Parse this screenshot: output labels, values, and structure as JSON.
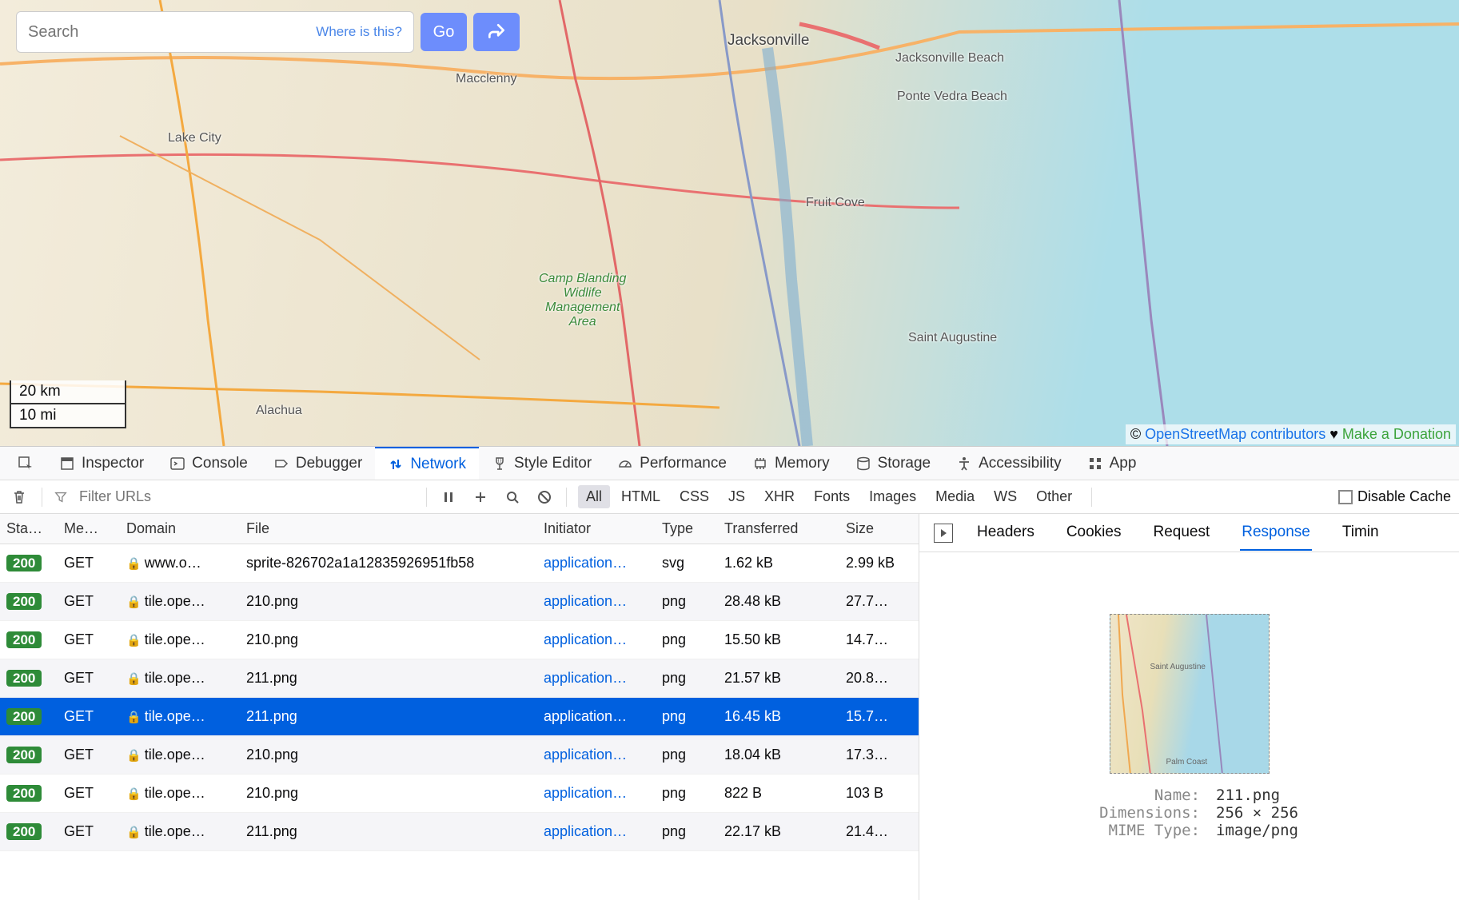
{
  "search": {
    "placeholder": "Search",
    "where_is_this": "Where is this?",
    "go_label": "Go"
  },
  "scale": {
    "km": "20 km",
    "mi": "10 mi"
  },
  "attribution": {
    "prefix": "© ",
    "link_text": "OpenStreetMap contributors",
    "heart": " ♥ ",
    "donate_text": "Make a Donation"
  },
  "map_labels": {
    "jacksonville": "Jacksonville",
    "jax_beach": "Jacksonville\nBeach",
    "ponte_vedra": "Ponte Vedra\nBeach",
    "fruit_cove": "Fruit Cove",
    "st_augustine": "Saint Augustine",
    "lake_city": "Lake City",
    "alachua": "Alachua",
    "macclenny": "Macclenny",
    "camp_blanding": "Camp Blanding\nWidlife\nManagement\nArea"
  },
  "devtools_tabs": [
    "Inspector",
    "Console",
    "Debugger",
    "Network",
    "Style Editor",
    "Performance",
    "Memory",
    "Storage",
    "Accessibility",
    "Application"
  ],
  "devtools_active_tab": "Network",
  "toolbar": {
    "filter_placeholder": "Filter URLs",
    "types": [
      "All",
      "HTML",
      "CSS",
      "JS",
      "XHR",
      "Fonts",
      "Images",
      "Media",
      "WS",
      "Other"
    ],
    "active_type": "All",
    "disable_cache": "Disable Cache"
  },
  "columns": {
    "status": "Sta…",
    "method": "Me…",
    "domain": "Domain",
    "file": "File",
    "initiator": "Initiator",
    "type": "Type",
    "transferred": "Transferred",
    "size": "Size"
  },
  "requests": [
    {
      "status": "200",
      "method": "GET",
      "domain": "www.o…",
      "file": "sprite-826702a1a12835926951fb58",
      "initiator": "application…",
      "type": "svg",
      "transferred": "1.62 kB",
      "size": "2.99 kB"
    },
    {
      "status": "200",
      "method": "GET",
      "domain": "tile.ope…",
      "file": "210.png",
      "initiator": "application…",
      "type": "png",
      "transferred": "28.48 kB",
      "size": "27.7…"
    },
    {
      "status": "200",
      "method": "GET",
      "domain": "tile.ope…",
      "file": "210.png",
      "initiator": "application…",
      "type": "png",
      "transferred": "15.50 kB",
      "size": "14.7…"
    },
    {
      "status": "200",
      "method": "GET",
      "domain": "tile.ope…",
      "file": "211.png",
      "initiator": "application…",
      "type": "png",
      "transferred": "21.57 kB",
      "size": "20.8…"
    },
    {
      "status": "200",
      "method": "GET",
      "domain": "tile.ope…",
      "file": "211.png",
      "initiator": "application…",
      "type": "png",
      "transferred": "16.45 kB",
      "size": "15.7…",
      "selected": true
    },
    {
      "status": "200",
      "method": "GET",
      "domain": "tile.ope…",
      "file": "210.png",
      "initiator": "application…",
      "type": "png",
      "transferred": "18.04 kB",
      "size": "17.3…"
    },
    {
      "status": "200",
      "method": "GET",
      "domain": "tile.ope…",
      "file": "210.png",
      "initiator": "application…",
      "type": "png",
      "transferred": "822 B",
      "size": "103 B"
    },
    {
      "status": "200",
      "method": "GET",
      "domain": "tile.ope…",
      "file": "211.png",
      "initiator": "application…",
      "type": "png",
      "transferred": "22.17 kB",
      "size": "21.4…"
    }
  ],
  "detail_tabs": [
    "Headers",
    "Cookies",
    "Request",
    "Response",
    "Timings"
  ],
  "detail_active_tab": "Response",
  "preview": {
    "name_k": "Name:",
    "name_v": "211.png",
    "dim_k": "Dimensions:",
    "dim_v": "256 × 256",
    "mime_k": "MIME Type:",
    "mime_v": "image/png",
    "tile_label1": "Saint Augustine",
    "tile_label2": "Palm Coast"
  }
}
